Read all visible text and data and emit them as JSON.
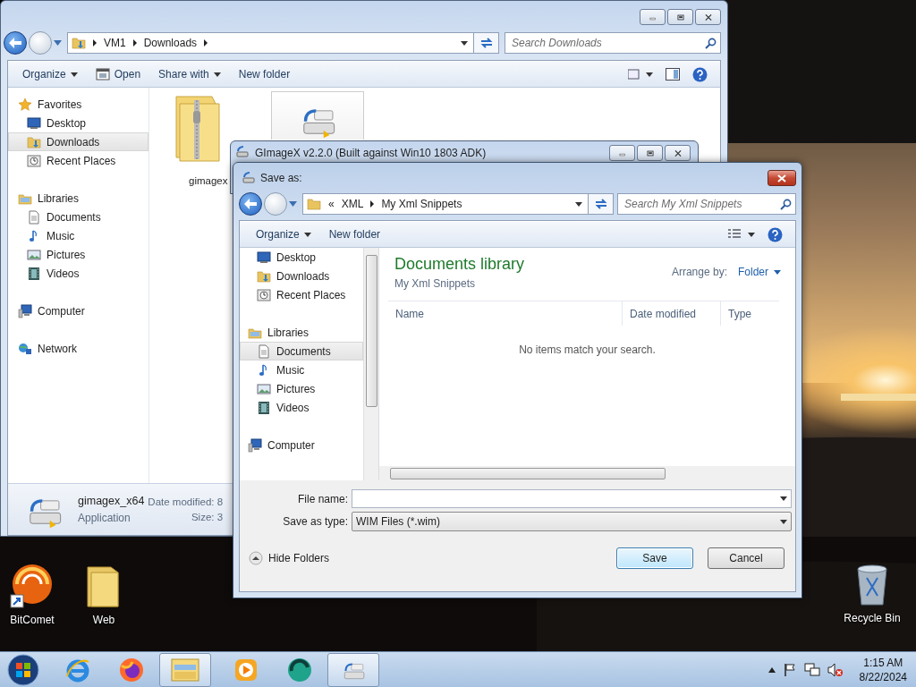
{
  "explorer": {
    "breadcrumb": [
      "VM1",
      "Downloads"
    ],
    "search_placeholder": "Search Downloads",
    "toolbar": [
      {
        "label": "Organize",
        "kind": "menu"
      },
      {
        "label": "Open",
        "kind": "icon"
      },
      {
        "label": "Share with",
        "kind": "menu"
      },
      {
        "label": "New folder",
        "kind": "plain"
      }
    ],
    "nav": [
      {
        "label": "Favorites",
        "kind": "star",
        "selected": false,
        "children": [
          {
            "label": "Desktop",
            "kind": "desktop",
            "selected": false
          },
          {
            "label": "Downloads",
            "kind": "downloads",
            "selected": true
          },
          {
            "label": "Recent Places",
            "kind": "recent",
            "selected": false
          }
        ]
      },
      {
        "label": "Libraries",
        "kind": "library",
        "selected": false,
        "children": [
          {
            "label": "Documents",
            "kind": "document",
            "selected": false
          },
          {
            "label": "Music",
            "kind": "music",
            "selected": false
          },
          {
            "label": "Pictures",
            "kind": "pictures",
            "selected": false
          },
          {
            "label": "Videos",
            "kind": "videos",
            "selected": false
          }
        ]
      },
      {
        "label": "Computer",
        "kind": "computer",
        "selected": false
      },
      {
        "label": "Network",
        "kind": "network",
        "selected": false
      }
    ],
    "files": [
      {
        "name": "gimagex",
        "kind": "zip"
      },
      {
        "kind": "app"
      }
    ],
    "details": {
      "name": "gimagex_x64",
      "type": "Application",
      "date_label": "Date modified: 8",
      "size_label": "Size: 3"
    }
  },
  "gimagex_window": {
    "title": "GImageX v2.2.0 (Built against Win10 1803 ADK)"
  },
  "save_dialog": {
    "title": "Save as:",
    "breadcrumb_prefix": "«",
    "breadcrumb": [
      "XML",
      "My Xml Snippets"
    ],
    "search_placeholder": "Search My Xml Snippets",
    "toolbar": [
      {
        "label": "Organize",
        "kind": "menu"
      },
      {
        "label": "New folder",
        "kind": "plain"
      }
    ],
    "nav": [
      {
        "children": [
          {
            "label": "Desktop",
            "kind": "desktop",
            "selected": false
          },
          {
            "label": "Downloads",
            "kind": "downloads",
            "selected": false
          },
          {
            "label": "Recent Places",
            "kind": "recent",
            "selected": false
          }
        ]
      },
      {
        "label": "Libraries",
        "kind": "library",
        "selected": false,
        "children": [
          {
            "label": "Documents",
            "kind": "document",
            "selected": true
          },
          {
            "label": "Music",
            "kind": "music",
            "selected": false
          },
          {
            "label": "Pictures",
            "kind": "pictures",
            "selected": false
          },
          {
            "label": "Videos",
            "kind": "videos",
            "selected": false
          }
        ]
      },
      {
        "label": "Computer",
        "kind": "computer",
        "selected": false
      }
    ],
    "library_title": "Documents library",
    "library_subtitle": "My Xml Snippets",
    "arrange_label": "Arrange by:",
    "arrange_value": "Folder",
    "columns": [
      "Name",
      "Date modified",
      "Type"
    ],
    "empty_message": "No items match your search.",
    "file_name_label": "File name:",
    "save_type_label": "Save as type:",
    "save_type": "WIM Files (*.wim)",
    "hide_folders": "Hide Folders",
    "buttons": [
      {
        "label": "Save",
        "kind": "default"
      },
      {
        "label": "Cancel",
        "kind": "normal"
      }
    ]
  },
  "desktop_icons": [
    {
      "label": "BitComet",
      "kind": "bitcomet"
    },
    {
      "label": "Web",
      "kind": "folder"
    },
    {
      "label": "Recycle Bin",
      "kind": "recycle"
    }
  ],
  "taskbar": {
    "apps": [
      {
        "kind": "ie",
        "selected": false
      },
      {
        "kind": "firefox",
        "selected": false
      },
      {
        "kind": "explorer",
        "selected": true
      },
      {
        "kind": "media",
        "selected": false
      },
      {
        "kind": "green",
        "selected": false
      },
      {
        "kind": "gimagex",
        "selected": true
      }
    ],
    "time": "1:15 AM",
    "date": "8/22/2024"
  }
}
